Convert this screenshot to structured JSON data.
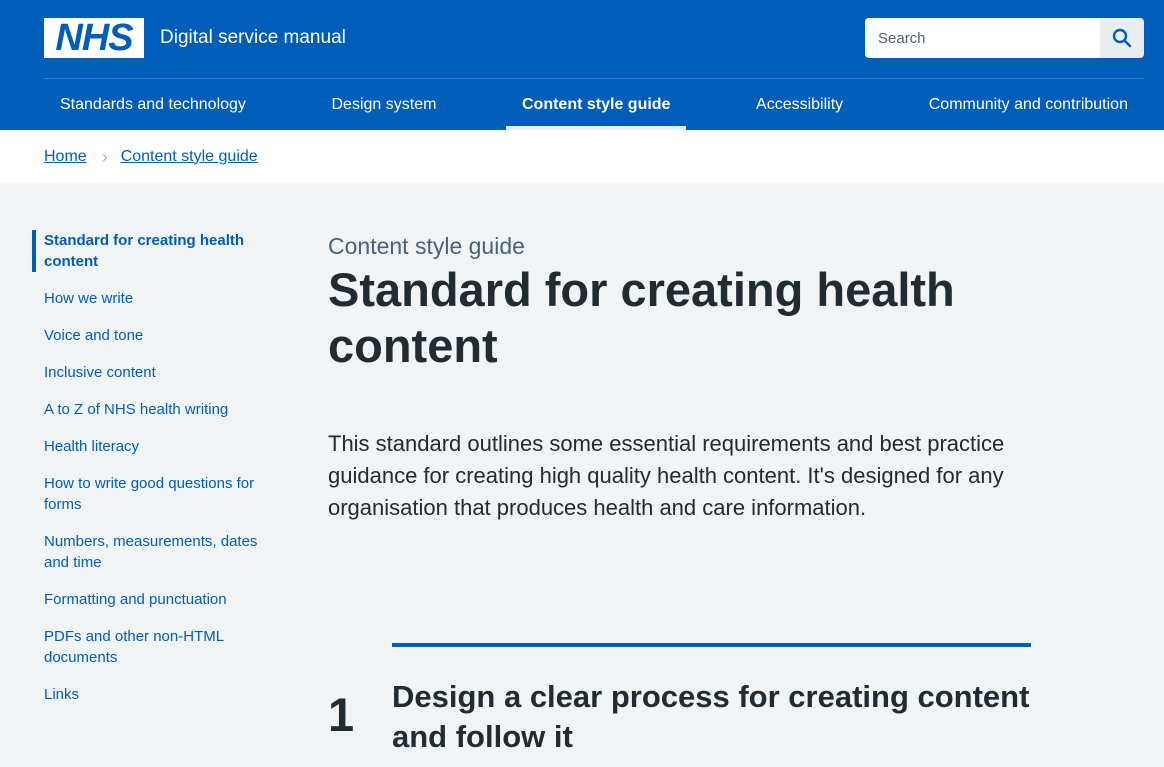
{
  "header": {
    "logo_text": "NHS",
    "service_name": "Digital service manual",
    "search_placeholder": "Search"
  },
  "nav": {
    "items": [
      {
        "label": "Standards and technology"
      },
      {
        "label": "Design system"
      },
      {
        "label": "Content style guide",
        "active": true
      },
      {
        "label": "Accessibility"
      },
      {
        "label": "Community and contribution"
      }
    ]
  },
  "breadcrumb": {
    "home": "Home",
    "current": "Content style guide",
    "separator": "›"
  },
  "sidebar": {
    "items": [
      {
        "label": "Standard for creating health content",
        "active": true
      },
      {
        "label": "How we write"
      },
      {
        "label": "Voice and tone"
      },
      {
        "label": "Inclusive content"
      },
      {
        "label": "A to Z of NHS health writing"
      },
      {
        "label": "Health literacy"
      },
      {
        "label": "How to write good questions for forms"
      },
      {
        "label": "Numbers, measurements, dates and time"
      },
      {
        "label": "Formatting and punctuation"
      },
      {
        "label": "PDFs and other non-HTML documents"
      },
      {
        "label": "Links"
      }
    ]
  },
  "main": {
    "caption": "Content style guide",
    "title": "Standard for creating health content",
    "lede": "This standard outlines some essential requirements and best practice guidance for creating high quality health content. It's designed for any organisation that produces health and care information.",
    "step": {
      "number": "1",
      "title": "Design a clear process for creating content and follow it"
    }
  },
  "colors": {
    "brand": "#005eb8",
    "background": "#f0f4f5",
    "text": "#212b32",
    "secondary_text": "#4c6272"
  },
  "icons": {
    "search": "search-icon"
  }
}
